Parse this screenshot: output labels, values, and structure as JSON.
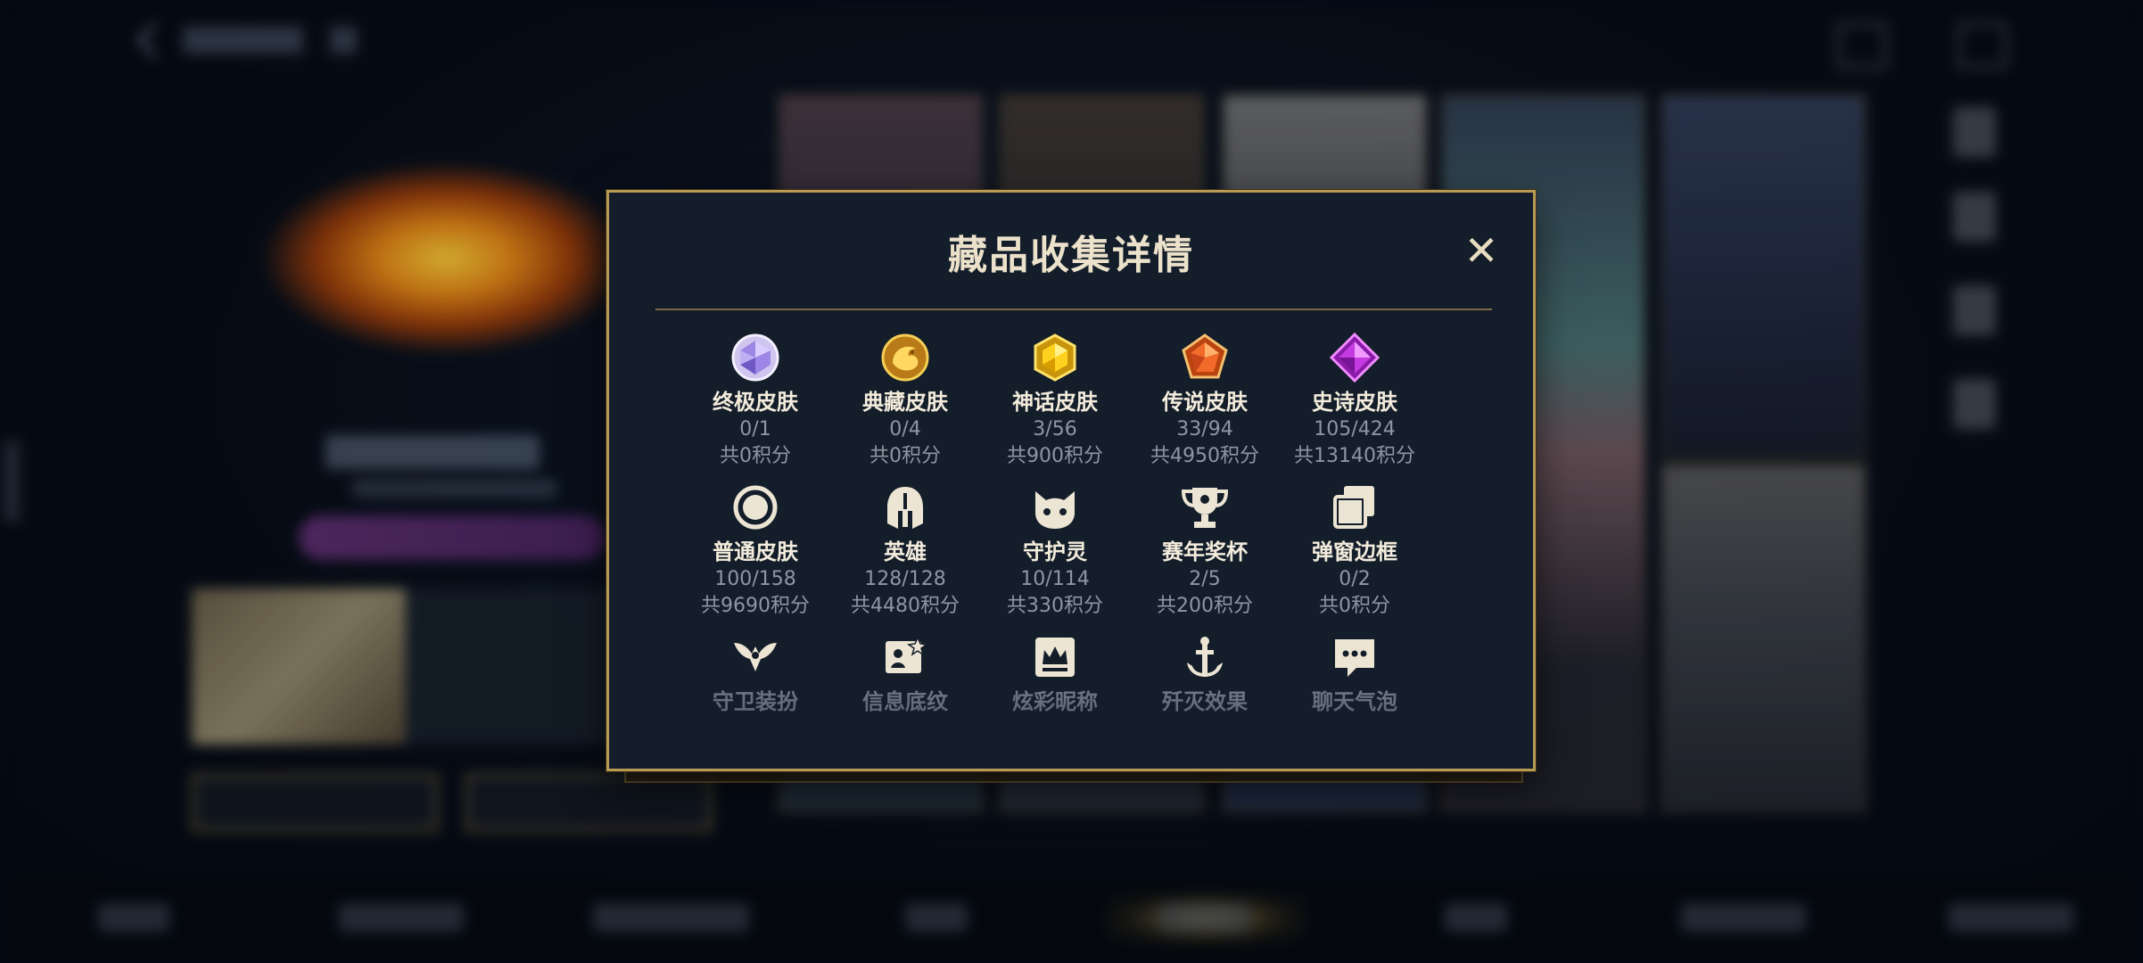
{
  "dialog": {
    "title": "藏品收集详情",
    "close_symbol": "✕"
  },
  "items": [
    {
      "label": "终极皮肤",
      "count": "0/1",
      "points": "共0积分",
      "icon": "ultimate-skin-gem-icon",
      "color": "#b9a6ff"
    },
    {
      "label": "典藏皮肤",
      "count": "0/4",
      "points": "共0积分",
      "icon": "collector-skin-dragon-icon",
      "color": "#e8b43a"
    },
    {
      "label": "神话皮肤",
      "count": "3/56",
      "points": "共900积分",
      "icon": "mythic-skin-gem-icon",
      "color": "#f0c020"
    },
    {
      "label": "传说皮肤",
      "count": "33/94",
      "points": "共4950积分",
      "icon": "legendary-skin-gem-icon",
      "color": "#e8602a"
    },
    {
      "label": "史诗皮肤",
      "count": "105/424",
      "points": "共13140积分",
      "icon": "epic-skin-gem-icon",
      "color": "#c03ad8"
    },
    {
      "label": "普通皮肤",
      "count": "100/158",
      "points": "共9690积分",
      "icon": "normal-skin-circle-icon",
      "color": "#e9e2d0"
    },
    {
      "label": "英雄",
      "count": "128/128",
      "points": "共4480积分",
      "icon": "hero-helmet-icon",
      "color": "#e9e2d0"
    },
    {
      "label": "守护灵",
      "count": "10/114",
      "points": "共330积分",
      "icon": "guardian-pet-icon",
      "color": "#e9e2d0"
    },
    {
      "label": "赛年奖杯",
      "count": "2/5",
      "points": "共200积分",
      "icon": "season-trophy-icon",
      "color": "#e9e2d0"
    },
    {
      "label": "弹窗边框",
      "count": "0/2",
      "points": "共0积分",
      "icon": "popup-frame-icon",
      "color": "#e9e2d0"
    },
    {
      "label": "守卫装扮",
      "icon": "ward-skin-icon",
      "color": "#cfc7b4"
    },
    {
      "label": "信息底纹",
      "icon": "info-card-icon",
      "color": "#cfc7b4"
    },
    {
      "label": "炫彩昵称",
      "icon": "colorful-nickname-icon",
      "color": "#cfc7b4"
    },
    {
      "label": "歼灭效果",
      "icon": "ace-effect-icon",
      "color": "#cfc7b4"
    },
    {
      "label": "聊天气泡",
      "icon": "chat-bubble-icon",
      "color": "#cfc7b4"
    }
  ]
}
